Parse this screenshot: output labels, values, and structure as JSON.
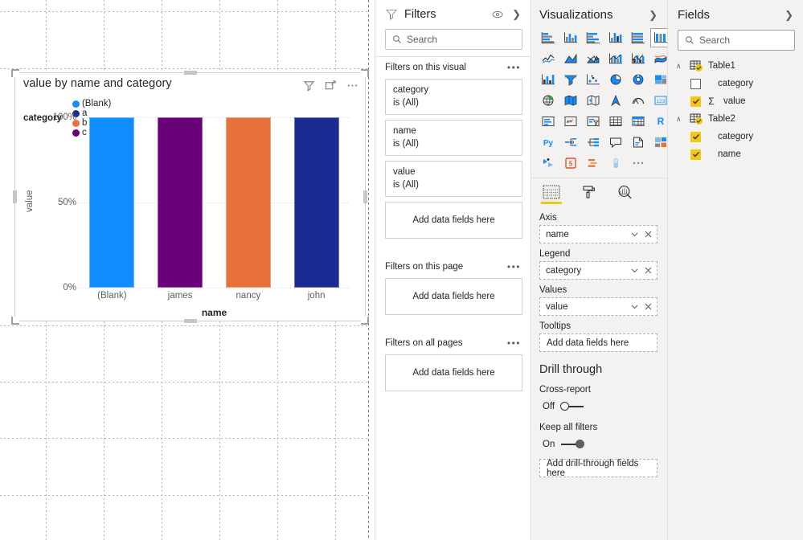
{
  "chart_data": {
    "type": "bar",
    "title": "value by name and category",
    "xlabel": "name",
    "ylabel": "value",
    "categories": [
      "(Blank)",
      "james",
      "nancy",
      "john"
    ],
    "series": [
      {
        "name": "(Blank)",
        "color": "#118DFF",
        "values": [
          100,
          0,
          0,
          0
        ]
      },
      {
        "name": "a",
        "color": "#1B2B91",
        "values": [
          0,
          0,
          0,
          100
        ]
      },
      {
        "name": "b",
        "color": "#E8703A",
        "values": [
          0,
          0,
          100,
          0
        ]
      },
      {
        "name": "c",
        "color": "#6B007B",
        "values": [
          0,
          100,
          0,
          0
        ]
      }
    ],
    "bar_colors": [
      "#118DFF",
      "#6B007B",
      "#E8703A",
      "#1B2B91"
    ],
    "values": [
      100,
      100,
      100,
      100
    ],
    "ylim": [
      0,
      100
    ],
    "yticks": [
      "0%",
      "50%",
      "100%"
    ],
    "ytick_values": [
      0,
      50,
      100
    ],
    "grid": true,
    "legend_position": "top",
    "legend_title": "category",
    "legend_items": [
      {
        "label": "(Blank)",
        "color": "#118DFF"
      },
      {
        "label": "a",
        "color": "#1B2B91"
      },
      {
        "label": "b",
        "color": "#E8703A"
      },
      {
        "label": "c",
        "color": "#6B007B"
      }
    ]
  },
  "visual": {
    "title": "value by name and category",
    "header_icons": [
      "filter-icon",
      "focus-mode-icon",
      "more-options-icon"
    ]
  },
  "filters": {
    "title": "Filters",
    "icons": [
      "filter-icon",
      "hide-eye-icon",
      "collapse-chevron-icon"
    ],
    "search_placeholder": "Search",
    "sections": [
      {
        "label": "Filters on this visual",
        "cards": [
          {
            "field": "category",
            "state": "is (All)"
          },
          {
            "field": "name",
            "state": "is (All)"
          },
          {
            "field": "value",
            "state": "is (All)"
          }
        ],
        "dropzone": "Add data fields here"
      },
      {
        "label": "Filters on this page",
        "cards": [],
        "dropzone": "Add data fields here"
      },
      {
        "label": "Filters on all pages",
        "cards": [],
        "dropzone": "Add data fields here"
      }
    ]
  },
  "visualizations": {
    "title": "Visualizations",
    "collapse_icon": "expand-chevron-icon",
    "icons": [
      "stacked-bar-chart",
      "stacked-column-chart",
      "clustered-bar-chart",
      "clustered-column-chart",
      "100-percent-stacked-bar-chart",
      "100-percent-stacked-column-chart",
      "line-chart",
      "area-chart",
      "stacked-area-chart",
      "line-and-stacked-column-chart",
      "line-and-clustered-column-chart",
      "ribbon-chart",
      "waterfall-chart",
      "funnel-chart",
      "scatter-chart",
      "pie-chart",
      "donut-chart",
      "treemap",
      "map",
      "filled-map",
      "shape-map",
      "arcgis-map",
      "gauge",
      "card",
      "multi-row-card",
      "kpi",
      "slicer",
      "table",
      "matrix",
      "r-script-visual",
      "python-visual",
      "decomposition-tree",
      "key-influencers",
      "smart-narrative",
      "paginated-report",
      "power-apps",
      "power-automate",
      "html-viewer",
      "gantt",
      "bullet-chart",
      "more-visuals"
    ],
    "selected_icon": "100-percent-stacked-column-chart",
    "tabs": [
      {
        "name": "fields-tab",
        "icon": "fields-grid-icon",
        "active": true
      },
      {
        "name": "format-tab",
        "icon": "paint-roller-icon",
        "active": false
      },
      {
        "name": "analytics-tab",
        "icon": "magnifier-chart-icon",
        "active": false
      }
    ],
    "wells": [
      {
        "label": "Axis",
        "value": "name",
        "empty": false
      },
      {
        "label": "Legend",
        "value": "category",
        "empty": false
      },
      {
        "label": "Values",
        "value": "value",
        "empty": false
      },
      {
        "label": "Tooltips",
        "value": "Add data fields here",
        "empty": true
      }
    ],
    "drill_through": {
      "title": "Drill through",
      "cross_report": {
        "label": "Cross-report",
        "state": "Off",
        "on": false
      },
      "keep_all_filters": {
        "label": "Keep all filters",
        "state": "On",
        "on": true
      },
      "dropzone": "Add drill-through fields here"
    }
  },
  "fields": {
    "title": "Fields",
    "collapse_icon": "expand-chevron-icon",
    "search_placeholder": "Search",
    "tables": [
      {
        "name": "Table1",
        "expanded": true,
        "items": [
          {
            "name": "category",
            "checked": false,
            "aggregate": false
          },
          {
            "name": "value",
            "checked": true,
            "aggregate": true
          }
        ]
      },
      {
        "name": "Table2",
        "expanded": true,
        "items": [
          {
            "name": "category",
            "checked": true,
            "aggregate": false
          },
          {
            "name": "name",
            "checked": true,
            "aggregate": false
          }
        ]
      }
    ]
  },
  "colors": {
    "accent_yellow": "#F2C811",
    "panel_bg": "#F3F2F1",
    "border": "#E1DFDD",
    "text": "#252423",
    "muted_text": "#605E5C"
  }
}
